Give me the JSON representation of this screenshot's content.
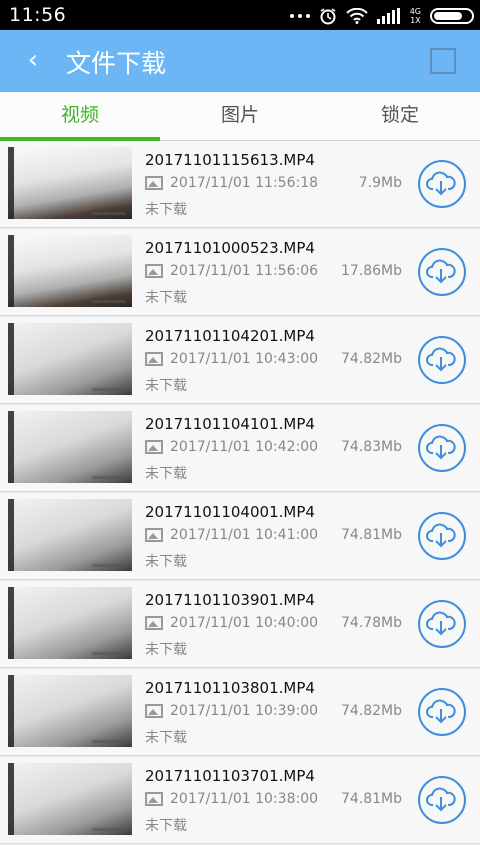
{
  "statusbar": {
    "time": "11:56",
    "network_top": "4G",
    "network_bottom": "1X"
  },
  "appbar": {
    "back_glyph": "‹",
    "title": "文件下载"
  },
  "tabs": [
    {
      "label": "视频"
    },
    {
      "label": "图片"
    },
    {
      "label": "锁定"
    }
  ],
  "files": [
    {
      "name": "20171101115613.MP4",
      "date": "2017/11/01 11:56:18",
      "size": "7.9Mb",
      "status": "未下载"
    },
    {
      "name": "20171101000523.MP4",
      "date": "2017/11/01 11:56:06",
      "size": "17.86Mb",
      "status": "未下载"
    },
    {
      "name": "20171101104201.MP4",
      "date": "2017/11/01 10:43:00",
      "size": "74.82Mb",
      "status": "未下载"
    },
    {
      "name": "20171101104101.MP4",
      "date": "2017/11/01 10:42:00",
      "size": "74.83Mb",
      "status": "未下载"
    },
    {
      "name": "20171101104001.MP4",
      "date": "2017/11/01 10:41:00",
      "size": "74.81Mb",
      "status": "未下载"
    },
    {
      "name": "20171101103901.MP4",
      "date": "2017/11/01 10:40:00",
      "size": "74.78Mb",
      "status": "未下载"
    },
    {
      "name": "20171101103801.MP4",
      "date": "2017/11/01 10:39:00",
      "size": "74.82Mb",
      "status": "未下载"
    },
    {
      "name": "20171101103701.MP4",
      "date": "2017/11/01 10:38:00",
      "size": "74.81Mb",
      "status": "未下载"
    }
  ],
  "colors": {
    "appbar": "#6db6f5",
    "tab_active": "#41b42a",
    "download_icon": "#3f8fe0"
  },
  "icons": {
    "back": "back-arrow-icon",
    "select": "select-square-icon",
    "image": "image-icon",
    "download": "cloud-download-icon"
  }
}
